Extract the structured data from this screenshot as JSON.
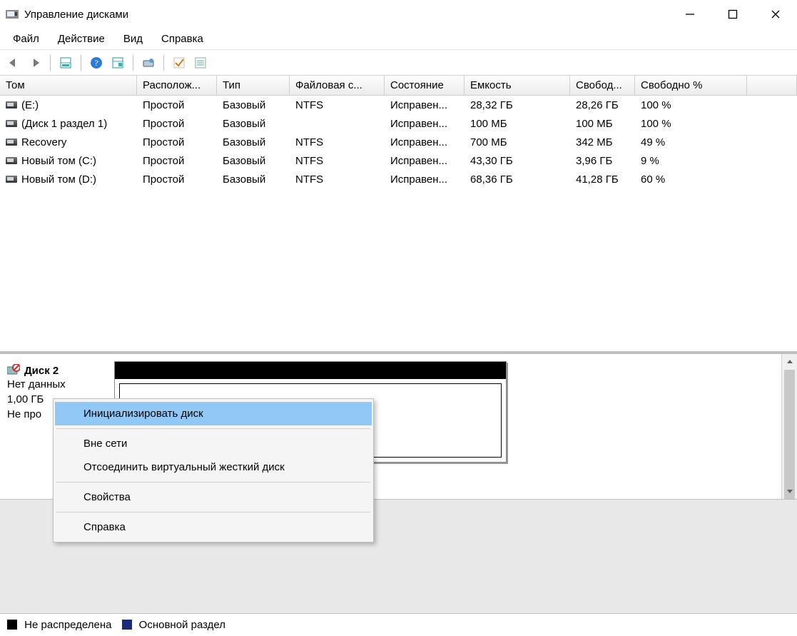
{
  "window": {
    "title": "Управление дисками"
  },
  "menu": {
    "file": "Файл",
    "action": "Действие",
    "view": "Вид",
    "help": "Справка"
  },
  "columns": {
    "c0": "Том",
    "c1": "Располож...",
    "c2": "Тип",
    "c3": "Файловая с...",
    "c4": "Состояние",
    "c5": "Емкость",
    "c6": "Свобод...",
    "c7": "Свободно %"
  },
  "volumes": [
    {
      "name": "(E:)",
      "layout": "Простой",
      "type": "Базовый",
      "fs": "NTFS",
      "status": "Исправен...",
      "cap": "28,32 ГБ",
      "free": "28,26 ГБ",
      "pct": "100 %"
    },
    {
      "name": "(Диск 1 раздел 1)",
      "layout": "Простой",
      "type": "Базовый",
      "fs": "",
      "status": "Исправен...",
      "cap": "100 МБ",
      "free": "100 МБ",
      "pct": "100 %"
    },
    {
      "name": "Recovery",
      "layout": "Простой",
      "type": "Базовый",
      "fs": "NTFS",
      "status": "Исправен...",
      "cap": "700 МБ",
      "free": "342 МБ",
      "pct": "49 %"
    },
    {
      "name": "Новый том (C:)",
      "layout": "Простой",
      "type": "Базовый",
      "fs": "NTFS",
      "status": "Исправен...",
      "cap": "43,30 ГБ",
      "free": "3,96 ГБ",
      "pct": "9 %"
    },
    {
      "name": "Новый том (D:)",
      "layout": "Простой",
      "type": "Базовый",
      "fs": "NTFS",
      "status": "Исправен...",
      "cap": "68,36 ГБ",
      "free": "41,28 ГБ",
      "pct": "60 %"
    }
  ],
  "disk": {
    "name": "Диск 2",
    "line1": "Нет данных",
    "line2": "1,00 ГБ",
    "line3": "Не про"
  },
  "context": {
    "init": "Инициализировать диск",
    "offline": "Вне сети",
    "detach": "Отсоединить виртуальный жесткий диск",
    "props": "Свойства",
    "help": "Справка"
  },
  "legend": {
    "unalloc": "Не распределена",
    "primary": "Основной раздел"
  }
}
